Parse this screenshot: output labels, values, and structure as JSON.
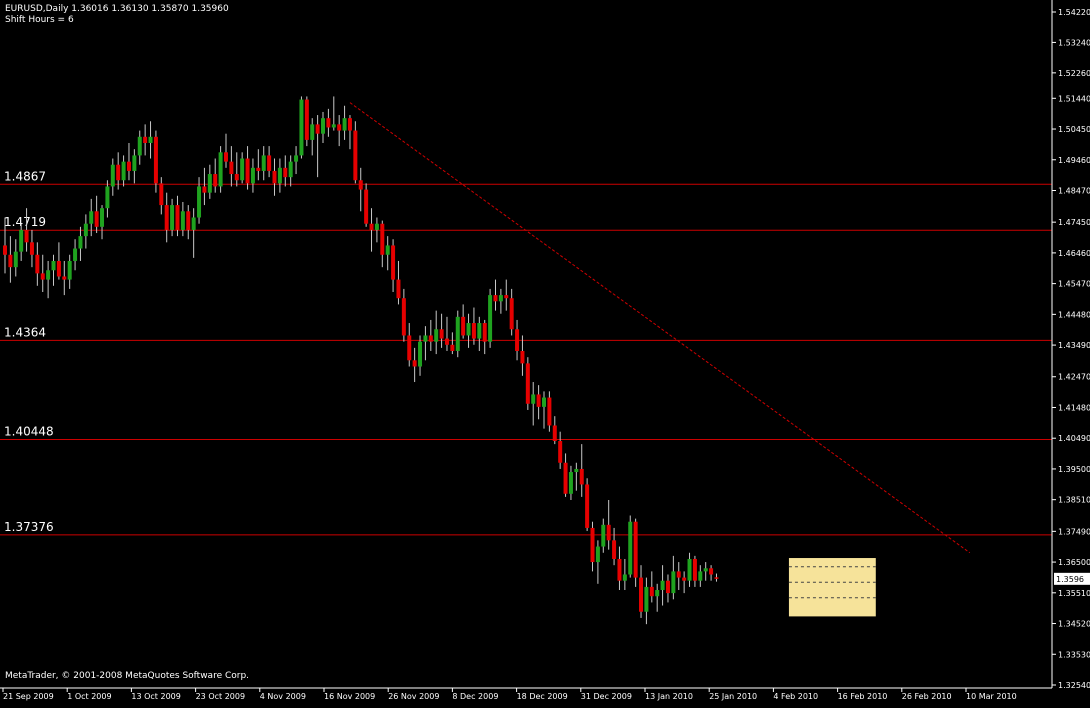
{
  "header": {
    "line1": "EURUSD,Daily  1.36016 1.36130 1.35870 1.35960",
    "line2": "Shift Hours = 6"
  },
  "footer": {
    "copyright": "MetaTrader, © 2001-2008 MetaQuotes Software Corp."
  },
  "colors": {
    "background": "#000000",
    "bull": "#1fa31f",
    "bear": "#e60000",
    "wick": "#c8c8c8",
    "level_line": "#cc0000",
    "trend_line": "#cc0000",
    "highlight_box": "#f6e39a",
    "axis": "#ffffff",
    "price_tag_bg": "#ffffff",
    "price_tag_text": "#000000"
  },
  "chart_data": {
    "type": "candlestick",
    "symbol": "EURUSD",
    "timeframe": "Daily",
    "last_bar": {
      "open": 1.36016,
      "high": 1.3613,
      "low": 1.3587,
      "close": 1.3596
    },
    "current_price_label": "1.3596",
    "y_ticks": [
      "1.54220",
      "1.53240",
      "1.52260",
      "1.51440",
      "1.50450",
      "1.49460",
      "1.48470",
      "1.47450",
      "1.46460",
      "1.45470",
      "1.44480",
      "1.43490",
      "1.42470",
      "1.41480",
      "1.40490",
      "1.39500",
      "1.38510",
      "1.37490",
      "1.36500",
      "1.35510",
      "1.34520",
      "1.33530",
      "1.32540"
    ],
    "x_ticks": [
      "21 Sep 2009",
      "1 Oct 2009",
      "13 Oct 2009",
      "23 Oct 2009",
      "4 Nov 2009",
      "16 Nov 2009",
      "26 Nov 2009",
      "8 Dec 2009",
      "18 Dec 2009",
      "31 Dec 2009",
      "13 Jan 2010",
      "25 Jan 2010",
      "4 Feb 2010",
      "16 Feb 2010",
      "26 Feb 2010",
      "10 Mar 2010"
    ],
    "levels": [
      {
        "label": "1.4867",
        "price": 1.4867
      },
      {
        "label": "1.4719",
        "price": 1.4719
      },
      {
        "label": "1.4364",
        "price": 1.4364
      },
      {
        "label": "1.40448",
        "price": 1.40448
      },
      {
        "label": "1.37376",
        "price": 1.37376
      }
    ],
    "trendline": {
      "from": {
        "bar": 64,
        "price": 1.513
      },
      "to": {
        "bar": 179,
        "price": 1.368
      }
    },
    "range_box": {
      "from_bar": 146,
      "to_bar": 161,
      "high": 1.3663,
      "low": 1.3475,
      "inner_lines": [
        1.3635,
        1.3585,
        1.3535
      ]
    },
    "ohlc": [
      [
        1.467,
        1.476,
        1.458,
        1.464
      ],
      [
        1.464,
        1.47,
        1.455,
        1.46
      ],
      [
        1.46,
        1.469,
        1.457,
        1.465
      ],
      [
        1.465,
        1.474,
        1.462,
        1.472
      ],
      [
        1.472,
        1.479,
        1.465,
        1.468
      ],
      [
        1.468,
        1.472,
        1.46,
        1.464
      ],
      [
        1.464,
        1.468,
        1.454,
        1.458
      ],
      [
        1.458,
        1.464,
        1.452,
        1.456
      ],
      [
        1.456,
        1.462,
        1.45,
        1.459
      ],
      [
        1.459,
        1.464,
        1.454,
        1.462
      ],
      [
        1.462,
        1.468,
        1.456,
        1.457
      ],
      [
        1.457,
        1.462,
        1.451,
        1.456
      ],
      [
        1.456,
        1.464,
        1.453,
        1.462
      ],
      [
        1.462,
        1.469,
        1.459,
        1.466
      ],
      [
        1.466,
        1.473,
        1.462,
        1.47
      ],
      [
        1.47,
        1.477,
        1.466,
        1.474
      ],
      [
        1.474,
        1.482,
        1.47,
        1.478
      ],
      [
        1.478,
        1.483,
        1.471,
        1.473
      ],
      [
        1.473,
        1.48,
        1.469,
        1.479
      ],
      [
        1.479,
        1.488,
        1.476,
        1.486
      ],
      [
        1.486,
        1.495,
        1.483,
        1.493
      ],
      [
        1.493,
        1.497,
        1.485,
        1.488
      ],
      [
        1.488,
        1.496,
        1.486,
        1.494
      ],
      [
        1.494,
        1.5,
        1.488,
        1.491
      ],
      [
        1.491,
        1.498,
        1.487,
        1.496
      ],
      [
        1.496,
        1.504,
        1.493,
        1.502
      ],
      [
        1.502,
        1.506,
        1.496,
        1.5
      ],
      [
        1.5,
        1.507,
        1.495,
        1.502
      ],
      [
        1.502,
        1.504,
        1.484,
        1.487
      ],
      [
        1.487,
        1.489,
        1.477,
        1.48
      ],
      [
        1.48,
        1.484,
        1.468,
        1.472
      ],
      [
        1.472,
        1.482,
        1.47,
        1.48
      ],
      [
        1.48,
        1.483,
        1.47,
        1.472
      ],
      [
        1.472,
        1.481,
        1.47,
        1.478
      ],
      [
        1.478,
        1.48,
        1.469,
        1.472
      ],
      [
        1.472,
        1.479,
        1.463,
        1.476
      ],
      [
        1.476,
        1.489,
        1.474,
        1.486
      ],
      [
        1.486,
        1.492,
        1.48,
        1.484
      ],
      [
        1.484,
        1.493,
        1.482,
        1.49
      ],
      [
        1.49,
        1.495,
        1.484,
        1.486
      ],
      [
        1.486,
        1.499,
        1.484,
        1.497
      ],
      [
        1.497,
        1.503,
        1.492,
        1.494
      ],
      [
        1.494,
        1.499,
        1.486,
        1.49
      ],
      [
        1.49,
        1.497,
        1.486,
        1.488
      ],
      [
        1.488,
        1.497,
        1.487,
        1.495
      ],
      [
        1.495,
        1.499,
        1.485,
        1.487
      ],
      [
        1.487,
        1.495,
        1.484,
        1.492
      ],
      [
        1.492,
        1.498,
        1.488,
        1.491
      ],
      [
        1.491,
        1.499,
        1.488,
        1.496
      ],
      [
        1.496,
        1.499,
        1.489,
        1.491
      ],
      [
        1.491,
        1.495,
        1.483,
        1.487
      ],
      [
        1.487,
        1.495,
        1.484,
        1.492
      ],
      [
        1.492,
        1.496,
        1.486,
        1.489
      ],
      [
        1.489,
        1.496,
        1.486,
        1.494
      ],
      [
        1.494,
        1.499,
        1.49,
        1.496
      ],
      [
        1.496,
        1.515,
        1.495,
        1.514
      ],
      [
        1.514,
        1.515,
        1.499,
        1.501
      ],
      [
        1.501,
        1.508,
        1.496,
        1.506
      ],
      [
        1.506,
        1.509,
        1.489,
        1.503
      ],
      [
        1.503,
        1.51,
        1.5,
        1.508
      ],
      [
        1.508,
        1.511,
        1.502,
        1.505
      ],
      [
        1.505,
        1.515,
        1.504,
        1.506
      ],
      [
        1.506,
        1.509,
        1.499,
        1.504
      ],
      [
        1.504,
        1.512,
        1.501,
        1.508
      ],
      [
        1.508,
        1.509,
        1.498,
        1.504
      ],
      [
        1.504,
        1.507,
        1.487,
        1.488
      ],
      [
        1.488,
        1.492,
        1.478,
        1.485
      ],
      [
        1.485,
        1.487,
        1.473,
        1.474
      ],
      [
        1.474,
        1.479,
        1.465,
        1.472
      ],
      [
        1.472,
        1.476,
        1.468,
        1.474
      ],
      [
        1.474,
        1.475,
        1.46,
        1.464
      ],
      [
        1.464,
        1.47,
        1.459,
        1.467
      ],
      [
        1.467,
        1.469,
        1.452,
        1.456
      ],
      [
        1.456,
        1.462,
        1.448,
        1.45
      ],
      [
        1.45,
        1.453,
        1.436,
        1.438
      ],
      [
        1.438,
        1.442,
        1.428,
        1.43
      ],
      [
        1.43,
        1.434,
        1.423,
        1.428
      ],
      [
        1.428,
        1.438,
        1.425,
        1.436
      ],
      [
        1.436,
        1.441,
        1.43,
        1.438
      ],
      [
        1.438,
        1.443,
        1.433,
        1.436
      ],
      [
        1.436,
        1.446,
        1.432,
        1.44
      ],
      [
        1.44,
        1.445,
        1.434,
        1.437
      ],
      [
        1.437,
        1.444,
        1.433,
        1.435
      ],
      [
        1.435,
        1.439,
        1.432,
        1.433
      ],
      [
        1.433,
        1.446,
        1.431,
        1.444
      ],
      [
        1.444,
        1.448,
        1.437,
        1.438
      ],
      [
        1.438,
        1.445,
        1.434,
        1.442
      ],
      [
        1.442,
        1.447,
        1.435,
        1.437
      ],
      [
        1.437,
        1.444,
        1.433,
        1.442
      ],
      [
        1.442,
        1.443,
        1.432,
        1.436
      ],
      [
        1.436,
        1.453,
        1.434,
        1.451
      ],
      [
        1.451,
        1.456,
        1.446,
        1.449
      ],
      [
        1.449,
        1.453,
        1.445,
        1.451
      ],
      [
        1.451,
        1.456,
        1.446,
        1.45
      ],
      [
        1.45,
        1.453,
        1.438,
        1.44
      ],
      [
        1.44,
        1.443,
        1.43,
        1.433
      ],
      [
        1.433,
        1.438,
        1.425,
        1.429
      ],
      [
        1.429,
        1.431,
        1.414,
        1.416
      ],
      [
        1.416,
        1.423,
        1.409,
        1.419
      ],
      [
        1.419,
        1.422,
        1.411,
        1.415
      ],
      [
        1.415,
        1.42,
        1.408,
        1.418
      ],
      [
        1.418,
        1.42,
        1.407,
        1.409
      ],
      [
        1.409,
        1.412,
        1.403,
        1.404
      ],
      [
        1.404,
        1.407,
        1.395,
        1.397
      ],
      [
        1.397,
        1.4,
        1.386,
        1.387
      ],
      [
        1.387,
        1.396,
        1.385,
        1.394
      ],
      [
        1.394,
        1.397,
        1.388,
        1.395
      ],
      [
        1.395,
        1.403,
        1.386,
        1.39
      ],
      [
        1.39,
        1.392,
        1.375,
        1.376
      ],
      [
        1.376,
        1.378,
        1.362,
        1.365
      ],
      [
        1.365,
        1.372,
        1.358,
        1.37
      ],
      [
        1.37,
        1.379,
        1.368,
        1.377
      ],
      [
        1.377,
        1.385,
        1.369,
        1.372
      ],
      [
        1.372,
        1.376,
        1.364,
        1.366
      ],
      [
        1.366,
        1.37,
        1.356,
        1.359
      ],
      [
        1.359,
        1.366,
        1.356,
        1.361
      ],
      [
        1.361,
        1.38,
        1.36,
        1.378
      ],
      [
        1.378,
        1.379,
        1.357,
        1.36
      ],
      [
        1.36,
        1.364,
        1.347,
        1.349
      ],
      [
        1.349,
        1.36,
        1.345,
        1.357
      ],
      [
        1.357,
        1.362,
        1.352,
        1.354
      ],
      [
        1.354,
        1.358,
        1.349,
        1.356
      ],
      [
        1.356,
        1.364,
        1.351,
        1.359
      ],
      [
        1.359,
        1.361,
        1.352,
        1.355
      ],
      [
        1.355,
        1.367,
        1.353,
        1.362
      ],
      [
        1.362,
        1.365,
        1.356,
        1.36
      ],
      [
        1.36,
        1.362,
        1.355,
        1.359
      ],
      [
        1.359,
        1.368,
        1.357,
        1.366
      ],
      [
        1.366,
        1.367,
        1.357,
        1.359
      ],
      [
        1.359,
        1.364,
        1.357,
        1.362
      ],
      [
        1.362,
        1.365,
        1.359,
        1.363
      ],
      [
        1.363,
        1.364,
        1.359,
        1.361
      ],
      [
        1.3601,
        1.3613,
        1.3587,
        1.3596
      ]
    ]
  }
}
